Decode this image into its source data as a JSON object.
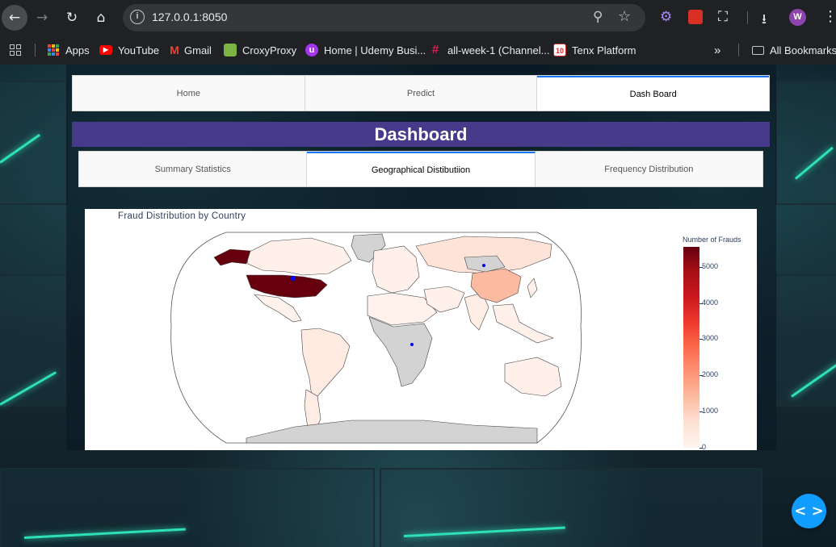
{
  "browser": {
    "url": "127.0.0.1:8050",
    "avatar_letter": "W",
    "bookmarks": [
      {
        "label": "Apps",
        "icon": "apps-grid-icon"
      },
      {
        "label": "YouTube",
        "icon": "youtube-icon",
        "color": "#ff0000"
      },
      {
        "label": "Gmail",
        "icon": "gmail-icon",
        "color": "#ea4335"
      },
      {
        "label": "CroxyProxy",
        "icon": "croxyproxy-icon",
        "color": "#7cb342"
      },
      {
        "label": "Home | Udemy Busi...",
        "icon": "udemy-icon",
        "color": "#a435f0"
      },
      {
        "label": "all-week-1 (Channel...",
        "icon": "slack-icon",
        "color": "#e01e5a"
      },
      {
        "label": "Tenx Platform",
        "icon": "tenx-icon",
        "color": "#d32f2f"
      }
    ],
    "all_bookmarks": "All Bookmarks"
  },
  "app": {
    "main_tabs": [
      {
        "label": "Home",
        "active": false
      },
      {
        "label": "Predict",
        "active": false
      },
      {
        "label": "Dash Board",
        "active": true
      }
    ],
    "header": "Dashboard",
    "sub_tabs": [
      {
        "label": "Summary Statistics",
        "active": false
      },
      {
        "label": "Geographical Distibutiion",
        "active": true
      },
      {
        "label": "Frequency Distribution",
        "active": false
      }
    ],
    "header_color": "#473a8a",
    "accent": "#1975fa"
  },
  "chart_data": {
    "type": "choropleth",
    "title": "Fraud Distribution by Country",
    "colorbar_title": "Number of Frauds",
    "colorscale": "Reds",
    "colorbar_range": [
      0,
      5550
    ],
    "colorbar_ticks": [
      0,
      1000,
      2000,
      3000,
      4000,
      5000
    ],
    "projection": "robinson",
    "regions": [
      {
        "name": "United States",
        "value": 5550
      },
      {
        "name": "China",
        "value": 1200
      },
      {
        "name": "Russia",
        "value": 250
      },
      {
        "name": "Brazil",
        "value": 150
      },
      {
        "name": "Canada",
        "value": 100
      },
      {
        "name": "India",
        "value": 120
      },
      {
        "name": "Australia",
        "value": 100
      },
      {
        "name": "Mexico",
        "value": 60
      },
      {
        "name": "Argentina",
        "value": 60
      },
      {
        "name": "Europe",
        "value": 150
      },
      {
        "name": "Middle East",
        "value": 40
      },
      {
        "name": "Southeast Asia",
        "value": 80
      }
    ]
  }
}
